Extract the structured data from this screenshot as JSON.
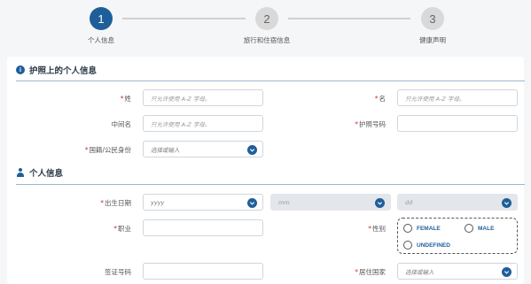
{
  "steps": [
    {
      "number": "1",
      "label": "个人信息"
    },
    {
      "number": "2",
      "label": "旅行和住宿信息"
    },
    {
      "number": "3",
      "label": "健康声明"
    }
  ],
  "section_passport": {
    "title": "护照上的个人信息"
  },
  "section_personal": {
    "title": "个人信息"
  },
  "fields": {
    "surname": {
      "label": "姓",
      "placeholder": "只允许使用 A-Z 字母。"
    },
    "given_name": {
      "label": "名",
      "placeholder": "只允许使用 A-Z 字母。"
    },
    "middle_name": {
      "label": "中间名",
      "placeholder": "只允许使用 A-Z 字母。"
    },
    "passport_number": {
      "label": "护照号码",
      "placeholder": ""
    },
    "nationality": {
      "label": "国籍/公民身份",
      "placeholder": "选择或输入"
    },
    "birth_date": {
      "label": "出生日期",
      "year": "yyyy",
      "month": "mm",
      "day": "dd"
    },
    "occupation": {
      "label": "职业",
      "placeholder": ""
    },
    "gender": {
      "label": "性别",
      "options": [
        "FEMALE",
        "MALE",
        "UNDEFINED"
      ]
    },
    "visa_number": {
      "label": "签证号码",
      "placeholder": ""
    },
    "residence_country": {
      "label": "居住国家",
      "placeholder": "选择或输入"
    }
  },
  "colors": {
    "accent": "#1f5f99",
    "required": "#d9302c"
  }
}
